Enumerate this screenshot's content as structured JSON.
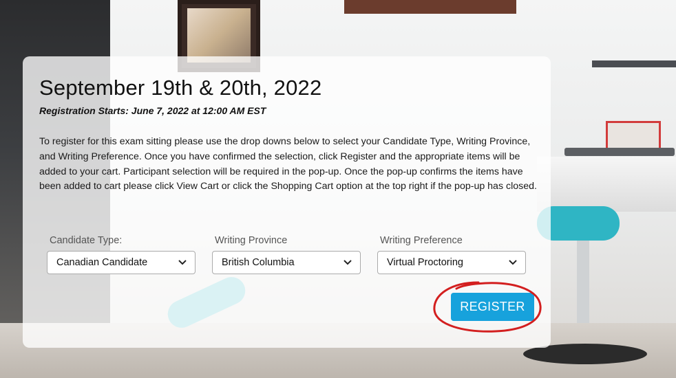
{
  "event": {
    "date_heading": "September 19th & 20th, 2022",
    "registration_start": "Registration Starts: June 7, 2022 at 12:00 AM EST",
    "instructions": "To register for this exam sitting please use the drop downs below to select your Candidate Type, Writing Province, and Writing Preference. Once you have confirmed the selection, click Register and the appropriate items will be added to your cart. Participant selection will be required in the pop-up. Once the pop-up confirms the items have been added to cart please click View Cart or click the Shopping Cart option at the top right if the pop-up has closed."
  },
  "form": {
    "candidate_type": {
      "label": "Candidate Type:",
      "value": "Canadian Candidate"
    },
    "writing_province": {
      "label": "Writing Province",
      "value": "British Columbia"
    },
    "writing_preference": {
      "label": "Writing Preference",
      "value": "Virtual Proctoring"
    },
    "register_label": "REGISTER"
  },
  "colors": {
    "button": "#17a2dc",
    "annotation_circle": "#d31f1f"
  },
  "icons": {
    "dropdown": "chevron-down-icon"
  }
}
